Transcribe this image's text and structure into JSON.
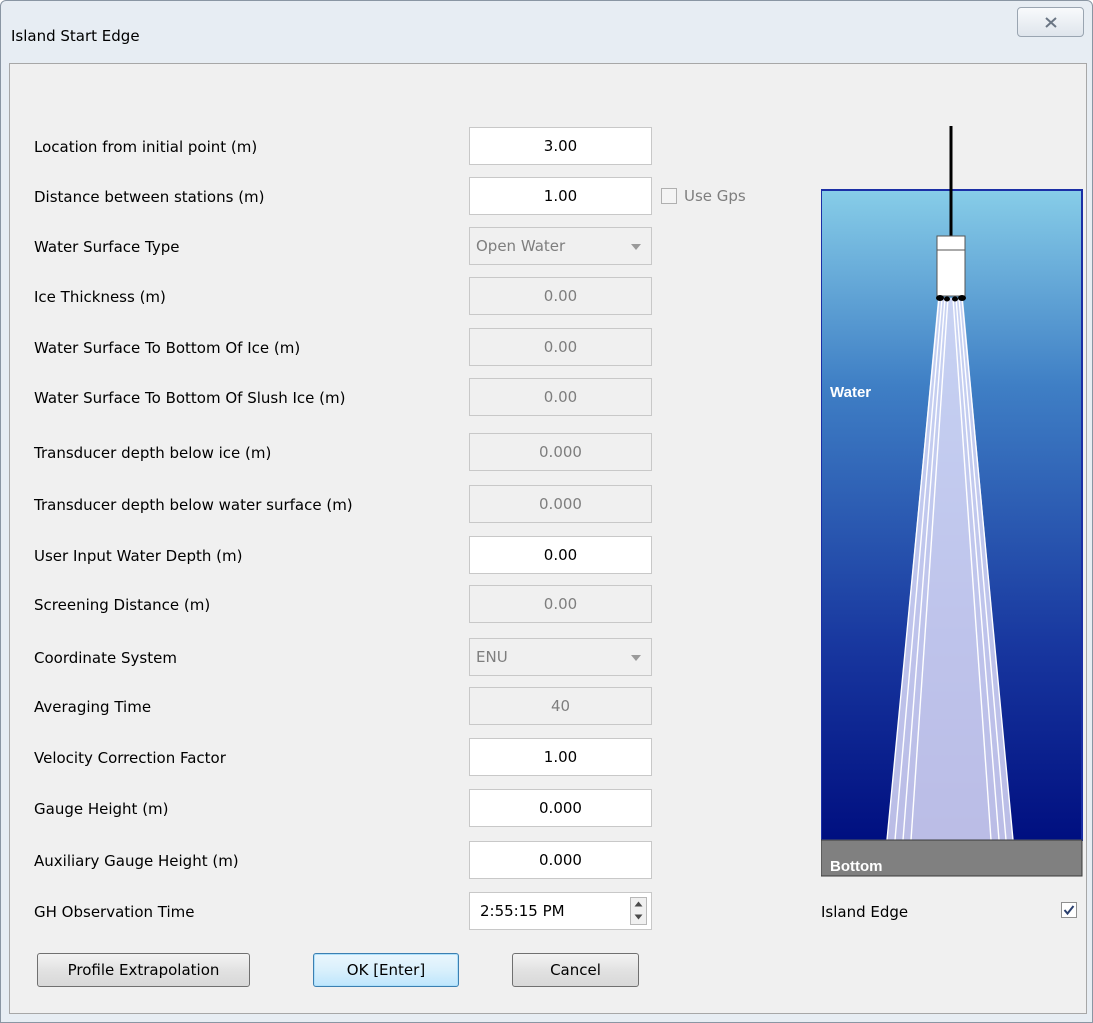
{
  "window": {
    "title": "Island Start Edge"
  },
  "fields": [
    {
      "label": "Location from initial point (m)",
      "value": "3.00",
      "enabled": true
    },
    {
      "label": "Distance between stations (m)",
      "value": "1.00",
      "enabled": true
    },
    {
      "label": "Water Surface Type",
      "value": "Open Water",
      "enabled": false
    },
    {
      "label": "Ice Thickness (m)",
      "value": "0.00",
      "enabled": false
    },
    {
      "label": "Water Surface To Bottom Of Ice (m)",
      "value": "0.00",
      "enabled": false
    },
    {
      "label": "Water Surface To Bottom Of Slush Ice (m)",
      "value": "0.00",
      "enabled": false
    },
    {
      "label": "Transducer depth below ice (m)",
      "value": "0.000",
      "enabled": false
    },
    {
      "label": "Transducer depth below water surface (m)",
      "value": "0.000",
      "enabled": false
    },
    {
      "label": "User Input Water Depth (m)",
      "value": "0.00",
      "enabled": true
    },
    {
      "label": "Screening Distance (m)",
      "value": "0.00",
      "enabled": false
    },
    {
      "label": "Coordinate System",
      "value": "ENU",
      "enabled": false
    },
    {
      "label": "Averaging Time",
      "value": "40",
      "enabled": false
    },
    {
      "label": "Velocity Correction Factor",
      "value": "1.00",
      "enabled": true
    },
    {
      "label": "Gauge Height (m)",
      "value": "0.000",
      "enabled": true
    },
    {
      "label": "Auxiliary Gauge Height (m)",
      "value": "0.000",
      "enabled": true
    },
    {
      "label": "GH Observation Time",
      "value": "2:55:15 PM",
      "enabled": true
    }
  ],
  "use_gps": {
    "label": "Use Gps",
    "checked": false,
    "enabled": false
  },
  "diagram": {
    "water_label": "Water",
    "bottom_label": "Bottom"
  },
  "island_edge": {
    "label": "Island Edge",
    "checked": true
  },
  "buttons": {
    "profile_extrapolation": "Profile Extrapolation",
    "ok": "OK [Enter]",
    "cancel": "Cancel"
  },
  "colors": {
    "water_top": "#87cde8",
    "water_bottom": "#000f80",
    "bottom": "#808080",
    "frame": "#1b2fa6"
  }
}
